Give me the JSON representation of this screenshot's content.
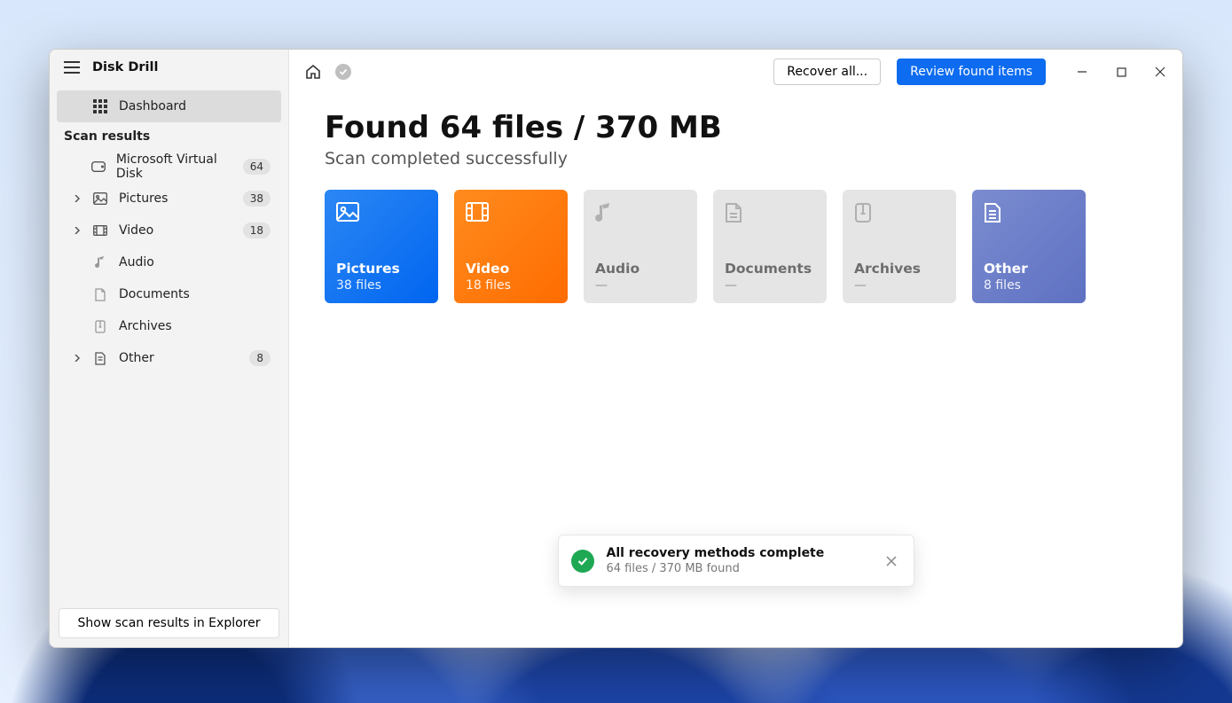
{
  "app": {
    "name": "Disk Drill"
  },
  "sidebar": {
    "dashboard_label": "Dashboard",
    "section_label": "Scan results",
    "items": [
      {
        "label": "Microsoft Virtual Disk",
        "count": "64"
      },
      {
        "label": "Pictures",
        "count": "38"
      },
      {
        "label": "Video",
        "count": "18"
      },
      {
        "label": "Audio",
        "count": ""
      },
      {
        "label": "Documents",
        "count": ""
      },
      {
        "label": "Archives",
        "count": ""
      },
      {
        "label": "Other",
        "count": "8"
      }
    ],
    "footer_button": "Show scan results in Explorer"
  },
  "topbar": {
    "recover_label": "Recover all...",
    "review_label": "Review found items"
  },
  "content": {
    "headline": "Found 64 files / 370 MB",
    "subhead": "Scan completed successfully",
    "cards": [
      {
        "title": "Pictures",
        "sub": "38 files"
      },
      {
        "title": "Video",
        "sub": "18 files"
      },
      {
        "title": "Audio",
        "sub": "—"
      },
      {
        "title": "Documents",
        "sub": "—"
      },
      {
        "title": "Archives",
        "sub": "—"
      },
      {
        "title": "Other",
        "sub": "8 files"
      }
    ]
  },
  "toast": {
    "title": "All recovery methods complete",
    "sub": "64 files / 370 MB found"
  }
}
